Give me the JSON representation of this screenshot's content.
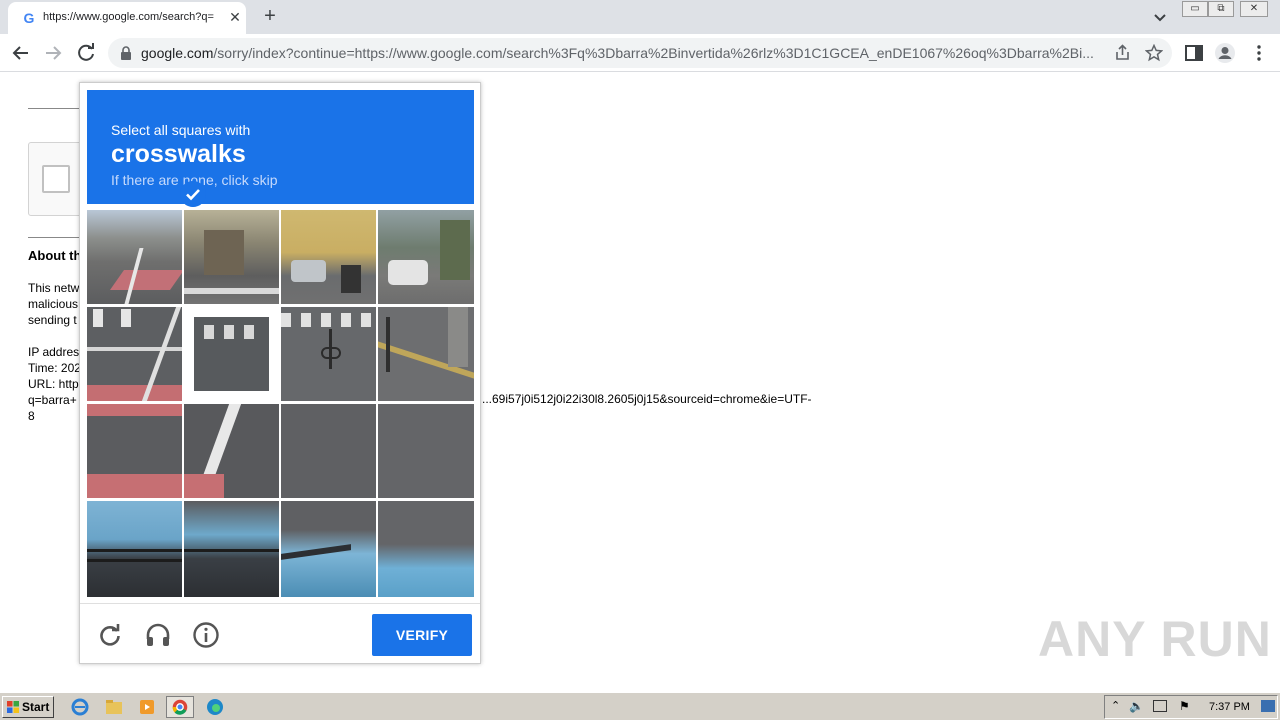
{
  "browser": {
    "tab_title": "https://www.google.com/search?q=",
    "tab_favicon": "G",
    "tab_close": "✕",
    "new_tab": "+",
    "url_domain": "google.com",
    "url_rest": "/sorry/index?continue=https://www.google.com/search%3Fq%3Dbarra%2Binvertida%26rlz%3D1C1GCEA_enDE1067%26oq%3Dbarra%2Bi...",
    "window_buttons": [
      "▭",
      "⧉",
      "✕"
    ]
  },
  "page": {
    "about_heading": "About th",
    "paragraph_lines": [
      "This netw",
      "malicious",
      "sending t"
    ],
    "ip_lines": [
      "IP addres",
      "Time: 202",
      "URL: http",
      "q=barra+",
      "8"
    ],
    "url_tail": "...69i57j0i512j0i22i30l8.2605j0j15&sourceid=chrome&ie=UTF-"
  },
  "captcha": {
    "instruction": "Select all squares with",
    "target": "crosswalks",
    "hint": "If there are none, click skip",
    "verify_label": "VERIFY",
    "selected_tile": 5
  },
  "watermark": "ANY RUN",
  "taskbar": {
    "start_label": "Start",
    "clock": "7:37 PM"
  },
  "icons": [
    "tab-search-icon",
    "back-icon",
    "forward-icon",
    "reload-icon",
    "lock-icon",
    "share-icon",
    "bookmark-star-icon",
    "side-panel-icon",
    "profile-icon",
    "menu-icon",
    "refresh-challenge-icon",
    "audio-challenge-icon",
    "info-icon",
    "checkmark-icon"
  ]
}
